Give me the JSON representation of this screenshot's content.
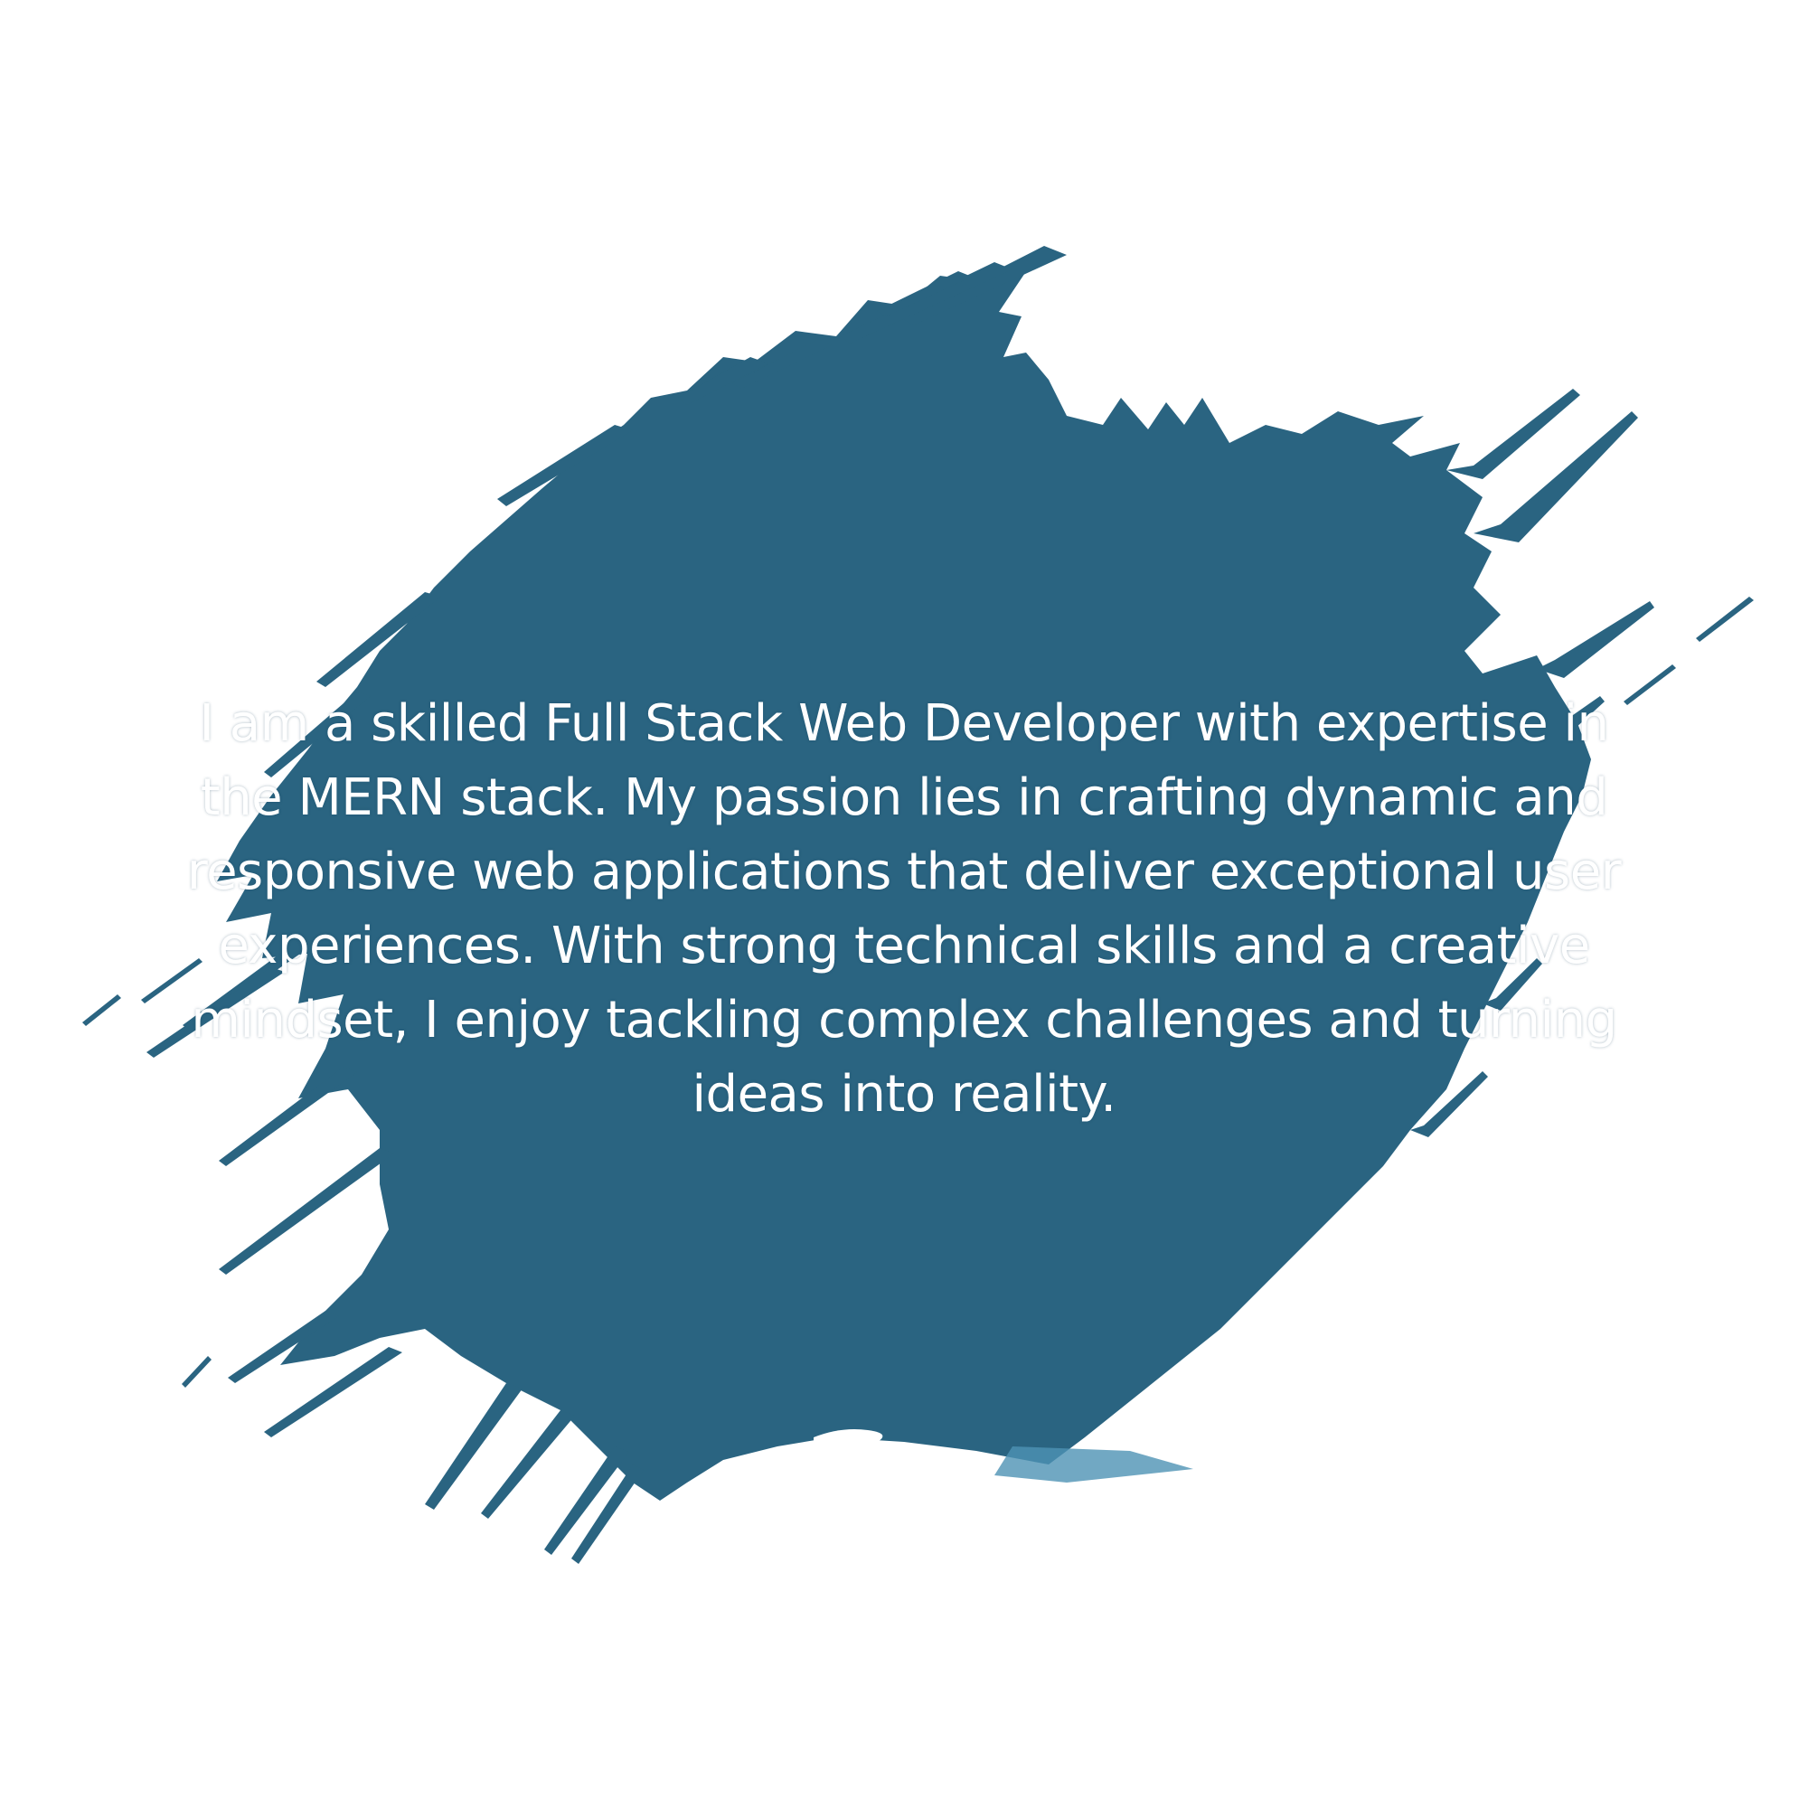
{
  "colors": {
    "background": "#ffffff",
    "splash": "#2a6481",
    "splash_light": "#4e92b4",
    "text": "#ffffff"
  },
  "splash": {
    "icon": "paint-brush-stroke"
  },
  "about": {
    "text": "I am a skilled Full Stack Web Developer with expertise in the MERN stack. My passion lies in crafting dynamic and responsive web applications that deliver exceptional user experiences. With strong technical skills and a creative mindset, I enjoy tackling complex challenges and turning ideas into reality."
  }
}
